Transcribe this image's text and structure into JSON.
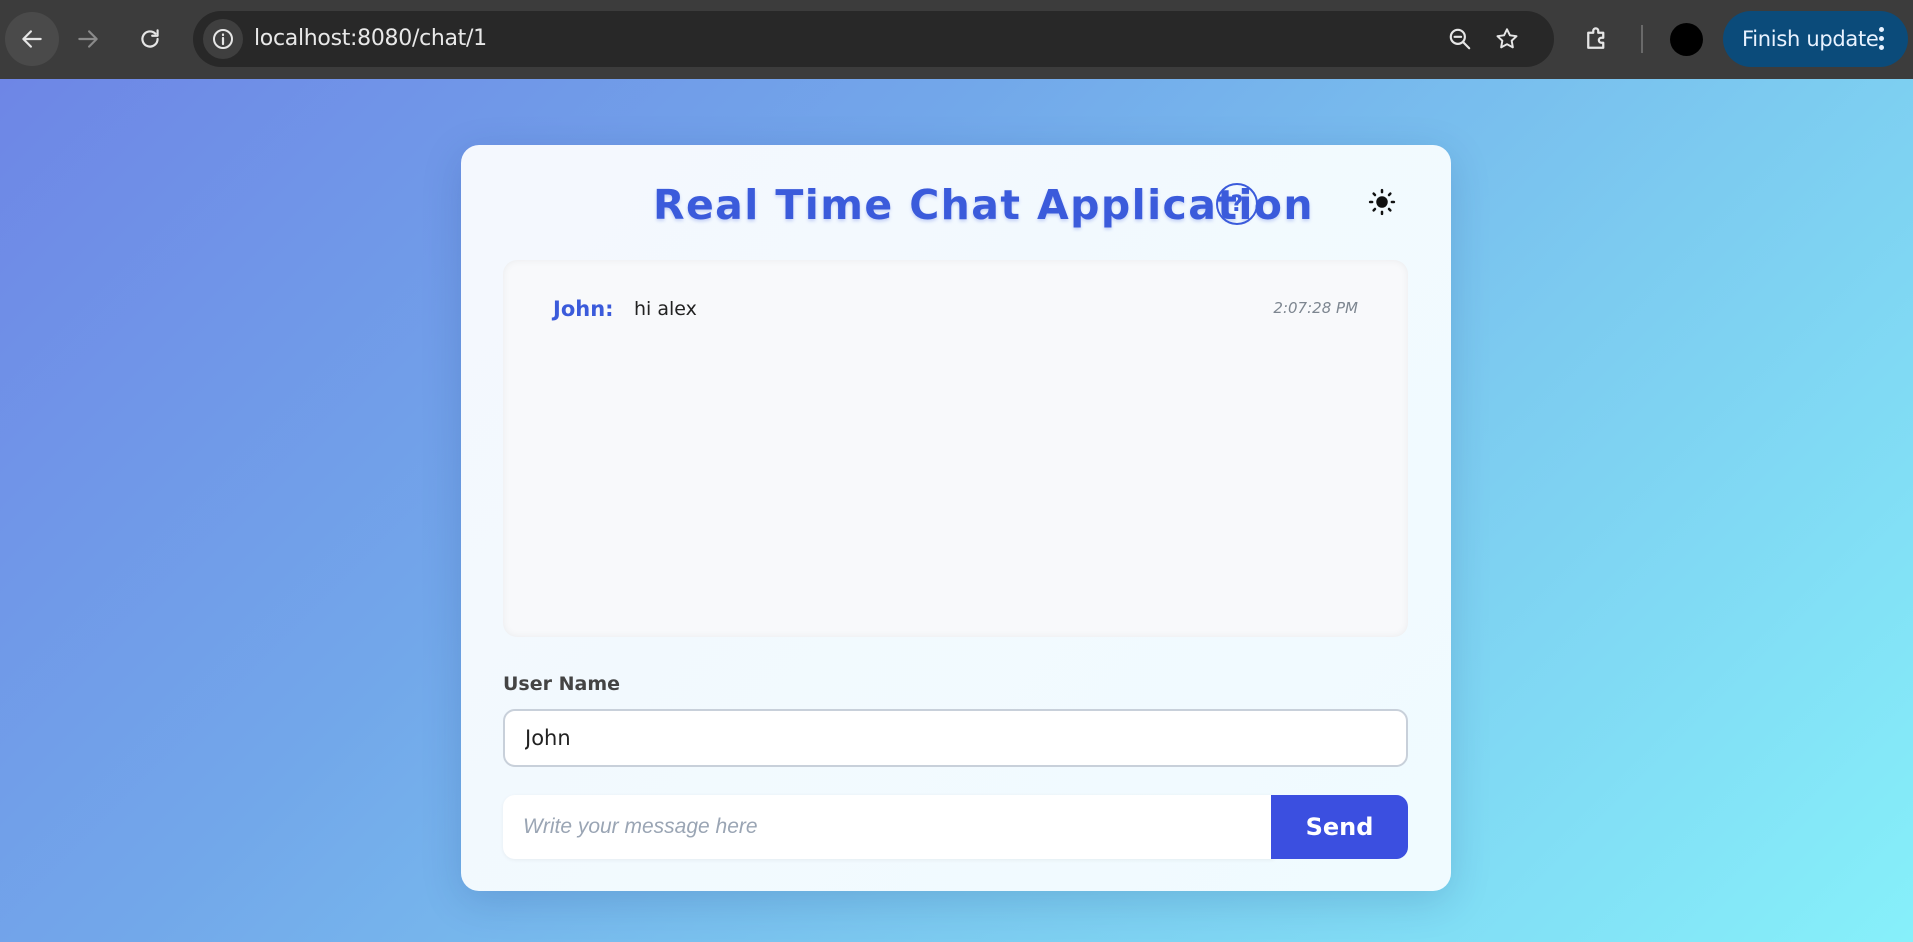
{
  "browser": {
    "url": "localhost:8080/chat/1",
    "update_button": "Finish update"
  },
  "app": {
    "title": "Real Time Chat Application",
    "help_label": "?",
    "accent_color": "#3b5bdb"
  },
  "messages": [
    {
      "sender": "John:",
      "text": "hi alex",
      "time": "2:07:28 PM"
    }
  ],
  "form": {
    "user_label": "User Name",
    "user_value": "John",
    "message_placeholder": "Write your message here",
    "message_value": "",
    "send_label": "Send"
  }
}
